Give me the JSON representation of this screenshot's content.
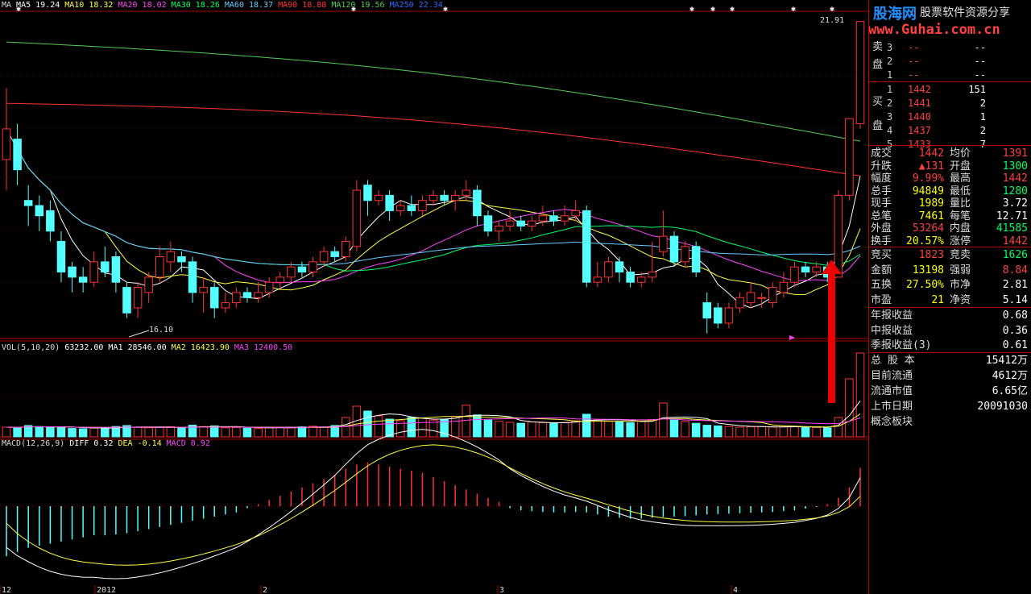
{
  "legends": {
    "ma": [
      {
        "label": "MA",
        "color": "#dddddd"
      },
      {
        "label": "MA5 19.24",
        "color": "#ffffff"
      },
      {
        "label": "MA10 18.32",
        "color": "#ffff44"
      },
      {
        "label": "MA20 18.02",
        "color": "#ff44ff"
      },
      {
        "label": "MA30 18.26",
        "color": "#00ff66"
      },
      {
        "label": "MA60 18.37",
        "color": "#66ccff"
      },
      {
        "label": "MA90 18.88",
        "color": "#ff3333"
      },
      {
        "label": "MA120 19.56",
        "color": "#55cc55"
      },
      {
        "label": "MA250 22.34",
        "color": "#3366ff"
      }
    ],
    "vol": [
      {
        "label": "VOL(5,10,20)",
        "color": "#dddddd"
      },
      {
        "label": "63232.00",
        "color": "#ffffff"
      },
      {
        "label": "MA1 28546.00",
        "color": "#ffffff"
      },
      {
        "label": "MA2 16423.90",
        "color": "#ffff44"
      },
      {
        "label": "MA3 12400.50",
        "color": "#ff44ff"
      }
    ],
    "macd": [
      {
        "label": "MACD(12,26,9)",
        "color": "#dddddd"
      },
      {
        "label": "DIFF 0.32",
        "color": "#ffffff"
      },
      {
        "label": "DEA -0.14",
        "color": "#ffff44"
      },
      {
        "label": "MACD 0.92",
        "color": "#ff44ff"
      }
    ]
  },
  "chart_data": {
    "type": "candlestick",
    "high_label": "21.91",
    "low_label": "16.10",
    "x_ticks": [
      "12",
      "2012",
      "2",
      "3",
      "4"
    ],
    "candles": [
      {
        "o": 19.2,
        "c": 19.8,
        "h": 20.6,
        "l": 18.6
      },
      {
        "o": 19.6,
        "c": 19.0,
        "h": 19.9,
        "l": 18.7
      },
      {
        "o": 18.4,
        "c": 18.3,
        "h": 18.7,
        "l": 17.9
      },
      {
        "o": 18.3,
        "c": 18.1,
        "h": 18.5,
        "l": 17.8
      },
      {
        "o": 18.2,
        "c": 17.8,
        "h": 18.4,
        "l": 17.6
      },
      {
        "o": 17.6,
        "c": 17.0,
        "h": 17.8,
        "l": 16.8
      },
      {
        "o": 17.1,
        "c": 16.9,
        "h": 17.2,
        "l": 16.6
      },
      {
        "o": 16.9,
        "c": 16.8,
        "h": 17.1,
        "l": 16.6
      },
      {
        "o": 16.8,
        "c": 17.2,
        "h": 17.4,
        "l": 16.7
      },
      {
        "o": 17.2,
        "c": 17.0,
        "h": 17.5,
        "l": 16.9
      },
      {
        "o": 17.3,
        "c": 16.8,
        "h": 17.4,
        "l": 16.6
      },
      {
        "o": 16.7,
        "c": 16.2,
        "h": 16.8,
        "l": 16.1
      },
      {
        "o": 16.3,
        "c": 16.7,
        "h": 16.8,
        "l": 16.1
      },
      {
        "o": 16.6,
        "c": 16.9,
        "h": 17.0,
        "l": 16.4
      },
      {
        "o": 16.9,
        "c": 17.3,
        "h": 17.5,
        "l": 16.8
      },
      {
        "o": 17.2,
        "c": 17.4,
        "h": 17.6,
        "l": 17.0
      },
      {
        "o": 17.3,
        "c": 17.2,
        "h": 17.4,
        "l": 17.0
      },
      {
        "o": 17.2,
        "c": 16.6,
        "h": 17.3,
        "l": 16.4
      },
      {
        "o": 16.6,
        "c": 16.7,
        "h": 16.9,
        "l": 16.2
      },
      {
        "o": 16.7,
        "c": 16.3,
        "h": 16.8,
        "l": 16.1
      },
      {
        "o": 16.3,
        "c": 16.4,
        "h": 16.6,
        "l": 16.2
      },
      {
        "o": 16.4,
        "c": 16.6,
        "h": 16.7,
        "l": 16.3
      },
      {
        "o": 16.6,
        "c": 16.5,
        "h": 16.7,
        "l": 16.4
      },
      {
        "o": 16.5,
        "c": 16.6,
        "h": 16.8,
        "l": 16.4
      },
      {
        "o": 16.6,
        "c": 16.8,
        "h": 16.9,
        "l": 16.5
      },
      {
        "o": 16.8,
        "c": 16.9,
        "h": 17.0,
        "l": 16.7
      },
      {
        "o": 16.9,
        "c": 17.1,
        "h": 17.2,
        "l": 16.8
      },
      {
        "o": 17.1,
        "c": 17.0,
        "h": 17.2,
        "l": 16.9
      },
      {
        "o": 17.0,
        "c": 17.2,
        "h": 17.3,
        "l": 16.9
      },
      {
        "o": 17.2,
        "c": 17.4,
        "h": 17.5,
        "l": 17.1
      },
      {
        "o": 17.4,
        "c": 17.3,
        "h": 17.5,
        "l": 17.2
      },
      {
        "o": 17.3,
        "c": 17.6,
        "h": 17.7,
        "l": 17.2
      },
      {
        "o": 17.5,
        "c": 18.6,
        "h": 18.8,
        "l": 17.4
      },
      {
        "o": 18.7,
        "c": 18.4,
        "h": 18.8,
        "l": 18.1
      },
      {
        "o": 18.4,
        "c": 18.5,
        "h": 18.6,
        "l": 18.3
      },
      {
        "o": 18.5,
        "c": 18.2,
        "h": 18.6,
        "l": 18.0
      },
      {
        "o": 18.2,
        "c": 18.3,
        "h": 18.4,
        "l": 18.1
      },
      {
        "o": 18.3,
        "c": 18.2,
        "h": 18.5,
        "l": 18.1
      },
      {
        "o": 18.2,
        "c": 18.4,
        "h": 18.5,
        "l": 18.1
      },
      {
        "o": 18.4,
        "c": 18.5,
        "h": 18.6,
        "l": 18.3
      },
      {
        "o": 18.5,
        "c": 18.4,
        "h": 18.6,
        "l": 18.3
      },
      {
        "o": 18.4,
        "c": 18.5,
        "h": 18.6,
        "l": 18.2
      },
      {
        "o": 18.5,
        "c": 18.6,
        "h": 18.8,
        "l": 18.4
      },
      {
        "o": 18.6,
        "c": 18.1,
        "h": 18.7,
        "l": 17.9
      },
      {
        "o": 18.1,
        "c": 17.8,
        "h": 18.2,
        "l": 17.7
      },
      {
        "o": 17.8,
        "c": 17.9,
        "h": 18.0,
        "l": 17.6
      },
      {
        "o": 17.9,
        "c": 18.0,
        "h": 18.2,
        "l": 17.8
      },
      {
        "o": 18.0,
        "c": 17.9,
        "h": 18.1,
        "l": 17.8
      },
      {
        "o": 17.9,
        "c": 18.0,
        "h": 18.1,
        "l": 17.8
      },
      {
        "o": 18.0,
        "c": 18.1,
        "h": 18.3,
        "l": 17.9
      },
      {
        "o": 18.1,
        "c": 18.0,
        "h": 18.2,
        "l": 17.9
      },
      {
        "o": 18.0,
        "c": 18.1,
        "h": 18.3,
        "l": 17.9
      },
      {
        "o": 18.1,
        "c": 18.2,
        "h": 18.4,
        "l": 18.0
      },
      {
        "o": 18.2,
        "c": 16.8,
        "h": 18.3,
        "l": 16.7
      },
      {
        "o": 16.8,
        "c": 16.9,
        "h": 17.2,
        "l": 16.7
      },
      {
        "o": 16.9,
        "c": 17.2,
        "h": 17.3,
        "l": 16.8
      },
      {
        "o": 17.2,
        "c": 17.0,
        "h": 17.3,
        "l": 16.8
      },
      {
        "o": 17.0,
        "c": 16.8,
        "h": 17.1,
        "l": 16.7
      },
      {
        "o": 16.8,
        "c": 16.9,
        "h": 17.0,
        "l": 16.7
      },
      {
        "o": 16.9,
        "c": 17.0,
        "h": 17.6,
        "l": 16.8
      },
      {
        "o": 17.4,
        "c": 17.7,
        "h": 18.2,
        "l": 17.3
      },
      {
        "o": 17.7,
        "c": 17.2,
        "h": 17.8,
        "l": 17.1
      },
      {
        "o": 17.2,
        "c": 17.5,
        "h": 17.6,
        "l": 17.1
      },
      {
        "o": 17.5,
        "c": 17.0,
        "h": 17.6,
        "l": 16.9
      },
      {
        "o": 16.4,
        "c": 16.1,
        "h": 16.6,
        "l": 15.8
      },
      {
        "o": 16.3,
        "c": 16.0,
        "h": 16.4,
        "l": 15.9
      },
      {
        "o": 16.0,
        "c": 16.3,
        "h": 16.4,
        "l": 15.9
      },
      {
        "o": 16.3,
        "c": 16.5,
        "h": 16.6,
        "l": 16.2
      },
      {
        "o": 16.4,
        "c": 16.6,
        "h": 16.8,
        "l": 16.3
      },
      {
        "o": 16.5,
        "c": 16.5,
        "h": 16.6,
        "l": 16.3
      },
      {
        "o": 16.4,
        "c": 16.7,
        "h": 16.8,
        "l": 16.3
      },
      {
        "o": 16.6,
        "c": 16.8,
        "h": 17.0,
        "l": 16.5
      },
      {
        "o": 16.8,
        "c": 17.1,
        "h": 17.2,
        "l": 16.7
      },
      {
        "o": 17.1,
        "c": 17.0,
        "h": 17.2,
        "l": 16.9
      },
      {
        "o": 17.0,
        "c": 17.1,
        "h": 17.2,
        "l": 16.9
      },
      {
        "o": 17.1,
        "c": 16.9,
        "h": 17.2,
        "l": 16.8
      },
      {
        "o": 16.9,
        "c": 18.5,
        "h": 18.6,
        "l": 16.9
      },
      {
        "o": 18.5,
        "c": 20.0,
        "h": 20.0,
        "l": 18.4
      },
      {
        "o": 19.9,
        "c": 21.9,
        "h": 21.9,
        "l": 19.8
      }
    ],
    "volumes": [
      3000,
      2800,
      3500,
      3200,
      3000,
      3100,
      2600,
      2500,
      2700,
      2800,
      3200,
      3500,
      3000,
      2800,
      2900,
      3100,
      2700,
      3600,
      3200,
      3400,
      2800,
      2900,
      2700,
      2600,
      2900,
      3000,
      2800,
      3100,
      3300,
      3000,
      3500,
      6000,
      9500,
      8000,
      6500,
      5500,
      5000,
      6000,
      5800,
      5200,
      5500,
      6200,
      9800,
      6800,
      5200,
      4800,
      4500,
      4200,
      4600,
      4400,
      4200,
      4500,
      5000,
      7000,
      5200,
      4800,
      4600,
      4400,
      4800,
      5400,
      10500,
      5200,
      4800,
      4200,
      3600,
      3400,
      3200,
      3000,
      3100,
      3200,
      3000,
      3100,
      3200,
      3000,
      2900,
      2800,
      6000,
      18000,
      26000
    ],
    "macd_bars": [
      -1.2,
      -1.1,
      -1.0,
      -0.95,
      -0.9,
      -0.85,
      -0.8,
      -0.75,
      -0.7,
      -0.7,
      -0.68,
      -0.65,
      -0.6,
      -0.55,
      -0.5,
      -0.45,
      -0.4,
      -0.35,
      -0.3,
      -0.25,
      -0.2,
      -0.15,
      -0.05,
      0.05,
      0.15,
      0.25,
      0.35,
      0.45,
      0.55,
      0.65,
      0.75,
      0.9,
      1.0,
      1.05,
      1.0,
      0.95,
      0.9,
      0.85,
      0.8,
      0.7,
      0.6,
      0.5,
      0.4,
      0.3,
      0.2,
      0.1,
      -0.05,
      -0.1,
      -0.12,
      -0.14,
      -0.15,
      -0.15,
      -0.14,
      -0.15,
      -0.2,
      -0.25,
      -0.28,
      -0.3,
      -0.3,
      -0.28,
      -0.26,
      -0.25,
      -0.24,
      -0.22,
      -0.2,
      -0.19,
      -0.18,
      -0.17,
      -0.16,
      -0.15,
      -0.14,
      -0.12,
      -0.1,
      -0.06,
      -0.02,
      0.05,
      0.2,
      0.45,
      0.92
    ],
    "cursor_marker_color": "#ff3333"
  },
  "watermark": {
    "brand": "股海网",
    "tagline": "股票软件资源分享",
    "url": "www.Guhai.com.cn"
  },
  "order_book": {
    "sell_label": "卖盘",
    "buy_label": "买盘",
    "sells": [
      {
        "level": "3",
        "price": "--",
        "vol": "--"
      },
      {
        "level": "2",
        "price": "--",
        "vol": "--"
      },
      {
        "level": "1",
        "price": "--",
        "vol": "--"
      }
    ],
    "buys": [
      {
        "level": "1",
        "price": "1442",
        "vol": "151"
      },
      {
        "level": "2",
        "price": "1441",
        "vol": "2"
      },
      {
        "level": "3",
        "price": "1440",
        "vol": "1"
      },
      {
        "level": "4",
        "price": "1437",
        "vol": "2"
      },
      {
        "level": "5",
        "price": "1433",
        "vol": "7"
      }
    ]
  },
  "quote": [
    {
      "k": "成交",
      "v1": "1442",
      "k2": "均价",
      "v2": "1391",
      "c1": "#ff4040",
      "c2": "#ff4040"
    },
    {
      "k": "升跌",
      "v1": "▲131",
      "k2": "开盘",
      "v2": "1300",
      "c1": "#ff4040",
      "c2": "#00ff66"
    },
    {
      "k": "幅度",
      "v1": "9.99%",
      "k2": "最高",
      "v2": "1442",
      "c1": "#ff4040",
      "c2": "#ff4040"
    },
    {
      "k": "总手",
      "v1": "94849",
      "k2": "最低",
      "v2": "1280",
      "c1": "#ffff00",
      "c2": "#00ff66"
    },
    {
      "k": "现手",
      "v1": "1989",
      "k2": "量比",
      "v2": "3.72",
      "c1": "#ffff00",
      "c2": "#ffffff"
    },
    {
      "k": "总笔",
      "v1": "7461",
      "k2": "每笔",
      "v2": "12.71",
      "c1": "#ffff00",
      "c2": "#ffffff"
    },
    {
      "k": "外盘",
      "v1": "53264",
      "k2": "内盘",
      "v2": "41585",
      "c1": "#ff4040",
      "c2": "#00ff66"
    },
    {
      "k": "换手",
      "v1": "20.57%",
      "k2": "涨停",
      "v2": "1442",
      "c1": "#ffff00",
      "c2": "#ff4040"
    }
  ],
  "quote2": [
    {
      "k": "竞买",
      "v1": "1823",
      "k2": "竞卖",
      "v2": "1626",
      "c1": "#ff4040",
      "c2": "#00ff66"
    },
    {
      "k": "金额",
      "v1": "13198",
      "k2": "强弱",
      "v2": "8.84",
      "c1": "#ffff00",
      "c2": "#ff4040"
    },
    {
      "k": "五换",
      "v1": "27.50%",
      "k2": "市净",
      "v2": "2.81",
      "c1": "#ffff00",
      "c2": "#ffffff"
    },
    {
      "k": "市盈",
      "v1": "21",
      "k2": "净资",
      "v2": "5.14",
      "c1": "#ffff00",
      "c2": "#ffffff"
    }
  ],
  "finance": [
    {
      "k": "年报收益",
      "v": "0.68"
    },
    {
      "k": "中报收益",
      "v": "0.36"
    },
    {
      "k": "季报收益(3)",
      "v": "0.61"
    }
  ],
  "shares": [
    {
      "k": "总 股 本",
      "v": "15412万"
    },
    {
      "k": "目前流通",
      "v": "4612万"
    },
    {
      "k": "流通市值",
      "v": "6.65亿"
    },
    {
      "k": "上市日期",
      "v": "20091030"
    },
    {
      "k": "概念板块",
      "v": ""
    }
  ]
}
